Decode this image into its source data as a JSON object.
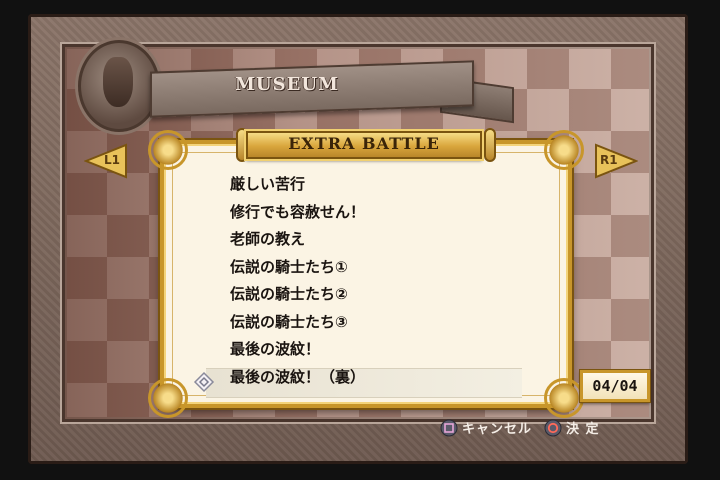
{
  "screen_title": "MUSEUM",
  "tab_title": "EXTRA BATTLE",
  "shoulder": {
    "left": "L1",
    "right": "R1"
  },
  "battles": [
    "厳しい苦行",
    "修行でも容赦せん！",
    "老師の教え",
    "伝説の騎士たち①",
    "伝説の騎士たち②",
    "伝説の騎士たち③",
    "最後の波紋！",
    "最後の波紋！（裏）"
  ],
  "selected_index": 7,
  "page_indicator": "04/04",
  "hints": {
    "cancel": "キャンセル",
    "confirm": "決 定"
  },
  "icons": {
    "cancel": "square-button-icon",
    "confirm": "circle-button-icon",
    "cursor": "pointer-cursor-icon"
  },
  "colors": {
    "gold": "#c8962a",
    "panel": "#fbf4e4",
    "text": "#1a1410"
  }
}
